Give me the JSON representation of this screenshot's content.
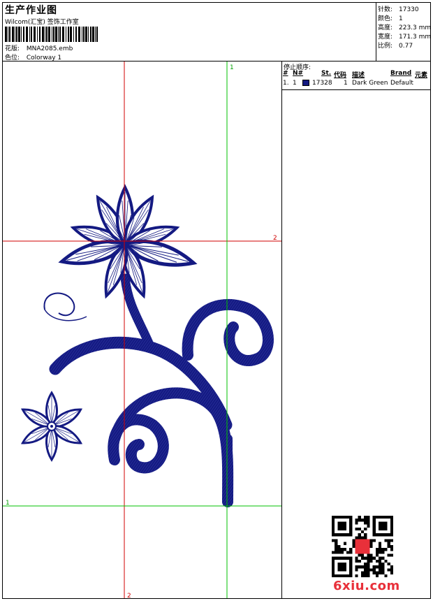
{
  "header": {
    "title": "生产作业图",
    "company": "Wilcom(汇宝) 签饰工作室",
    "design_label": "花版:",
    "design_value": "MNA2085.emb",
    "colorway_label": "色位:",
    "colorway_value": "Colorway 1"
  },
  "stats": [
    {
      "label": "针数:",
      "value": "17330"
    },
    {
      "label": "颜色:",
      "value": "1"
    },
    {
      "label": "高度:",
      "value": "223.3 mm"
    },
    {
      "label": "宽度:",
      "value": "171.3 mm"
    },
    {
      "label": "比例:",
      "value": "0.77"
    }
  ],
  "stop_sequence": {
    "title": "停止顺序:",
    "headers": {
      "num": "#",
      "n": "N#",
      "st": "St.",
      "code": "代码",
      "desc": "描述",
      "brand": "Brand",
      "elem": "元素"
    },
    "rows": [
      {
        "num": "1.",
        "n": "1",
        "st": "17328",
        "code": "1",
        "desc": "Dark Green",
        "brand": "Default",
        "elem": "",
        "color": "#141a82"
      }
    ]
  },
  "guides": {
    "v_red": "2",
    "h_red": "2",
    "v_green": "1",
    "h_green": "1"
  },
  "colors": {
    "thread": "#141a82",
    "guide_red": "#d00000",
    "guide_green": "#00c000",
    "brand": "#e8303a"
  },
  "watermark": {
    "brand": "6xiu.com"
  }
}
